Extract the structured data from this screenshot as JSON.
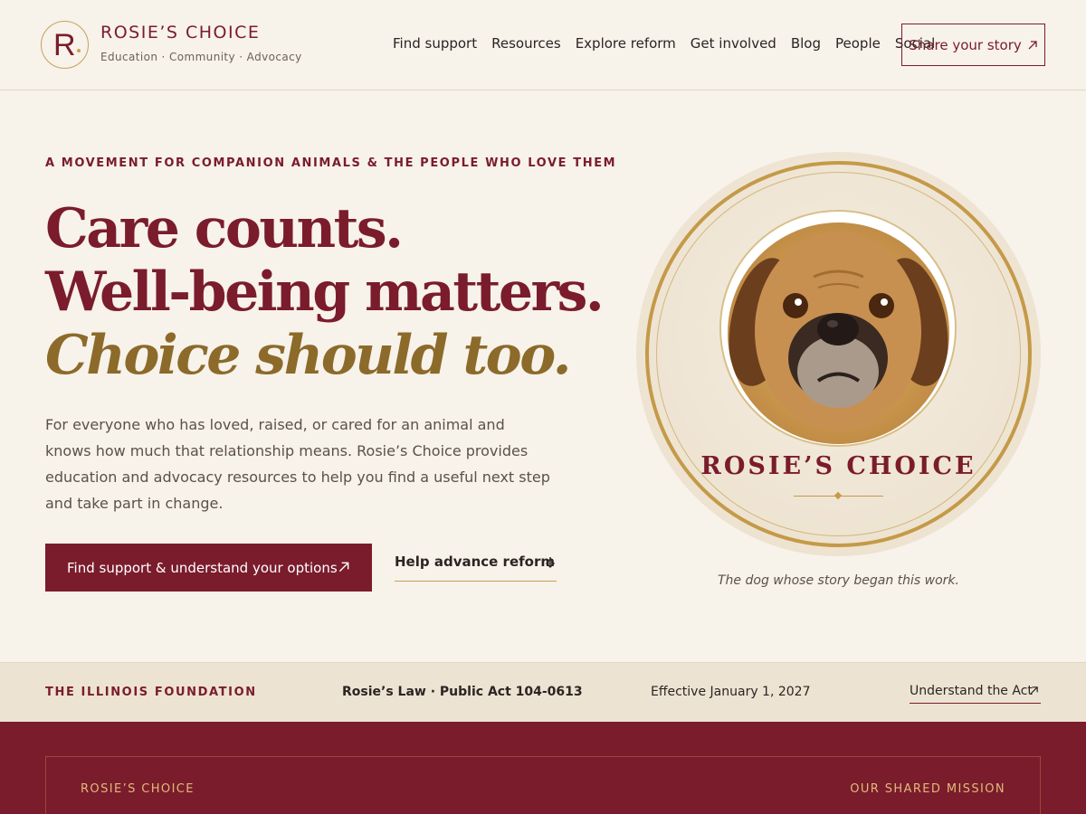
{
  "brand": {
    "logo_letter": "R",
    "name": "ROSIE’S CHOICE",
    "tagline": "Education · Community · Advocacy"
  },
  "nav": {
    "items": [
      "Find support",
      "Resources",
      "Explore reform",
      "Get involved",
      "Blog",
      "People",
      "Social"
    ],
    "cta_label": "Share your story",
    "cta_icon": "arrow-up-right-icon"
  },
  "hero": {
    "eyebrow": "A MOVEMENT FOR COMPANION ANIMALS & THE PEOPLE WHO LOVE THEM",
    "headline_line1": "Care counts.",
    "headline_line2": "Well-being matters.",
    "headline_line3": "Choice should too.",
    "body": "For everyone who has loved, raised, or cared for an animal and knows how much that relationship means. Rosie’s Choice provides education and advocacy resources to help you find a useful next step and take part in change.",
    "primary_button": "Find support & understand your options",
    "secondary_link": "Help advance reform"
  },
  "medallion": {
    "name": "ROSIE’S CHOICE",
    "caption": "The dog whose story began this work."
  },
  "info_bar": {
    "foundation": "THE ILLINOIS FOUNDATION",
    "law": "Rosie’s Law · Public Act 104-0613",
    "effective": "Effective January 1, 2027",
    "link": "Understand the Act"
  },
  "band": {
    "left": "ROSIE’S CHOICE",
    "right": "OUR SHARED MISSION"
  },
  "colors": {
    "brand": "#7a1c2c",
    "gold": "#c49a48",
    "background": "#f7f2ea",
    "infobar": "#ede3d3"
  }
}
